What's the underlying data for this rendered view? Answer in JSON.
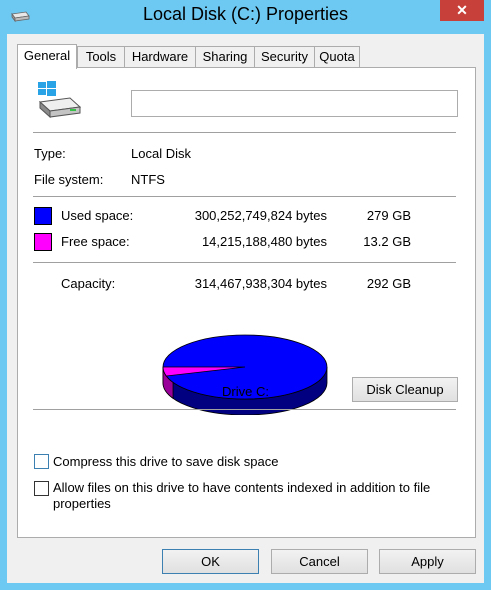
{
  "window": {
    "title": "Local Disk (C:) Properties",
    "close_label": "✕"
  },
  "tabs": [
    {
      "label": "General",
      "active": true
    },
    {
      "label": "Tools"
    },
    {
      "label": "Hardware"
    },
    {
      "label": "Sharing"
    },
    {
      "label": "Security"
    },
    {
      "label": "Quota"
    }
  ],
  "general": {
    "drive_name_value": "",
    "type_label": "Type:",
    "type_value": "Local Disk",
    "fs_label": "File system:",
    "fs_value": "NTFS",
    "used": {
      "label": "Used space:",
      "bytes": "300,252,749,824 bytes",
      "size": "279 GB",
      "color": "#0000ff"
    },
    "free": {
      "label": "Free space:",
      "bytes": "14,215,188,480 bytes",
      "size": "13.2 GB",
      "color": "#ff00ff"
    },
    "capacity": {
      "label": "Capacity:",
      "bytes": "314,467,938,304 bytes",
      "size": "292 GB"
    },
    "drive_label": "Drive C:",
    "cleanup_button": "Disk Cleanup",
    "compress_label": "Compress this drive to save disk space",
    "compress_checked": false,
    "index_label_line1": "Allow files on this drive to have contents indexed in addition to file",
    "index_label_line2": "properties",
    "index_checked": false
  },
  "chart_data": {
    "type": "pie",
    "values": [
      300252749824,
      14215188480
    ],
    "labels": [
      "Used space",
      "Free space"
    ],
    "colors": [
      "#0000ff",
      "#ff00ff"
    ]
  },
  "buttons": {
    "ok": "OK",
    "cancel": "Cancel",
    "apply": "Apply"
  }
}
